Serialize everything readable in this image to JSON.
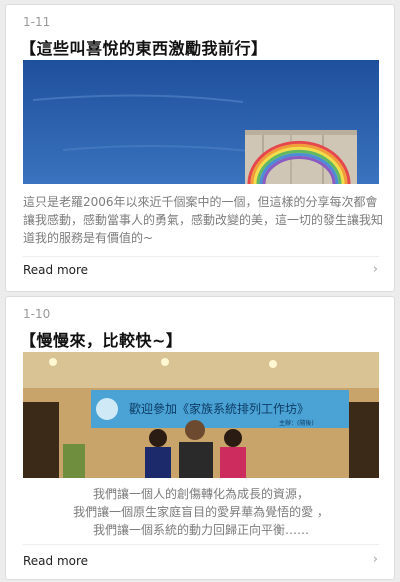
{
  "posts": [
    {
      "date": "1-11",
      "title": "【這些叫喜悅的東西激勵我前行】",
      "description": "這只是老羅2006年以來近千個案中的一個，但這樣的分享每次都會讓我感動，感動當事人的勇氣，感動改變的美，這一切的發生讓我知道我的服務是有價值的~",
      "read_more": "Read more"
    },
    {
      "date": "1-10",
      "title": "【慢慢來，比較快~】",
      "description_lines": [
        "我們讓一個人的創傷轉化為成長的資源，",
        "我們讓一個原生家庭盲目的愛昇華為覺悟的愛 ，",
        "我們讓一個系統的動力回歸正向平衡……"
      ],
      "banner_text": "歡迎參加《家族系統排列工作坊》",
      "banner_subtext": "主辦：(隨後)",
      "read_more": "Read more"
    }
  ],
  "icons": {
    "read_more": "chevron-right-icon"
  },
  "colors": {
    "background": "#ececec",
    "card": "#ffffff",
    "sky": "#2b5fa8",
    "banner": "#4aa3d4"
  }
}
